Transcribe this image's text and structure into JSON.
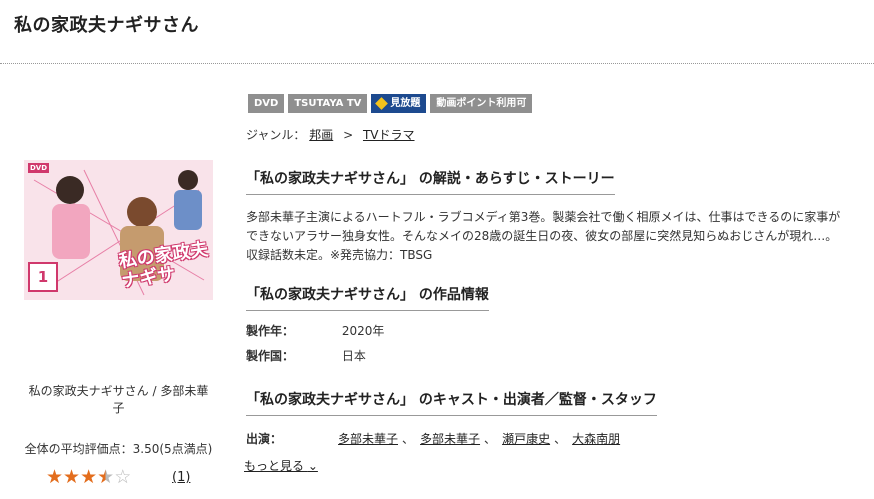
{
  "header": {
    "title": "私の家政夫ナギサさん"
  },
  "tags": [
    "DVD",
    "TSUTAYA TV",
    "見放題",
    "動画ポイント利用可"
  ],
  "genre": {
    "label": "ジャンル：",
    "crumb1": "邦画",
    "sep": ">",
    "crumb2": "TVドラマ"
  },
  "cover": {
    "dvd_badge": "DVD",
    "volume": "1",
    "logo_line1": "私の家政夫",
    "logo_line2": "ナギサ"
  },
  "sidebar": {
    "title": "私の家政夫ナギサさん / 多部未華子",
    "avg_rating": "全体の平均評価点：3.50(5点満点)",
    "rating_value": 3.5,
    "rating_max": 5,
    "review_count": "(1)"
  },
  "synopsis": {
    "heading": "「私の家政夫ナギサさん」 の解説・あらすじ・ストーリー",
    "text": "多部未華子主演によるハートフル・ラブコメディ第3巻。製薬会社で働く相原メイは、仕事はできるのに家事ができないアラサー独身女性。そんなメイの28歳の誕生日の夜、彼女の部屋に突然見知らぬおじさんが現れ…。収録話数未定。※発売協力：TBSG"
  },
  "info": {
    "heading": "「私の家政夫ナギサさん」 の作品情報",
    "year_label": "製作年：",
    "year": "2020年",
    "country_label": "製作国：",
    "country": "日本"
  },
  "cast": {
    "heading": "「私の家政夫ナギサさん」 のキャスト・出演者／監督・スタッフ",
    "label": "出演：",
    "members": [
      "多部未華子",
      "多部未華子",
      "瀬戸康史",
      "大森南朋"
    ],
    "more": "もっと見る"
  },
  "colors": {
    "star": "#e36d1d",
    "tag_gray": "#8f8f8f",
    "tag_plan": "#1d4a8f",
    "accent_pink": "#d0386c"
  }
}
